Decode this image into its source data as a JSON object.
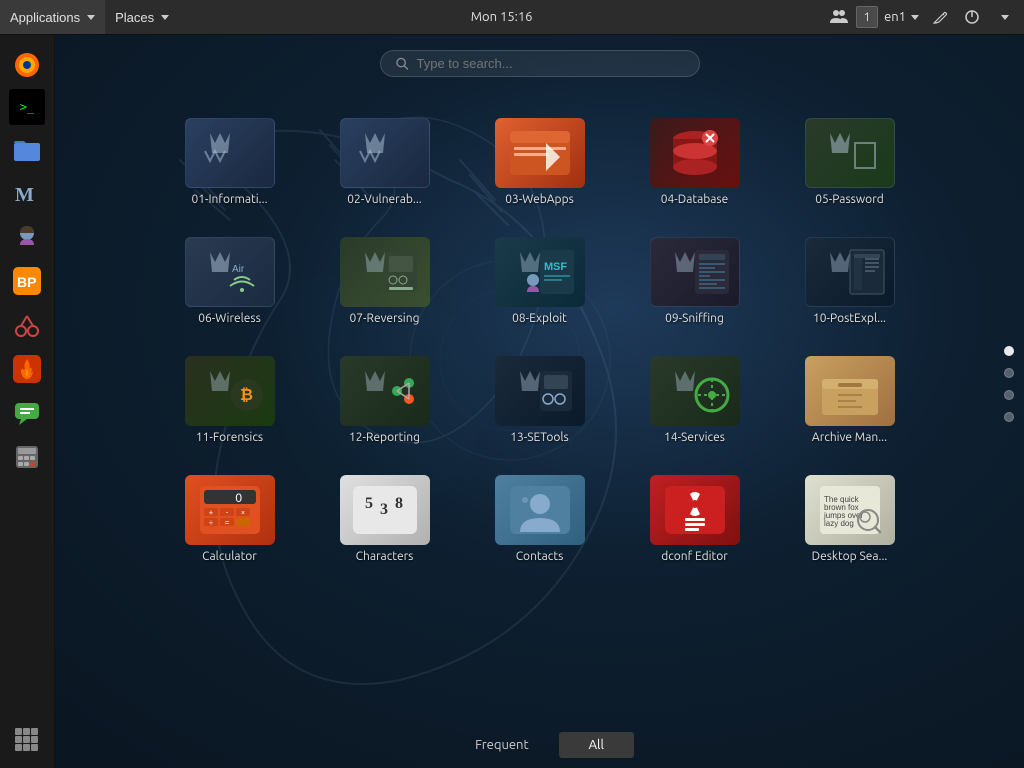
{
  "topbar": {
    "applications_label": "Applications",
    "places_label": "Places",
    "clock": "Mon 15:16",
    "workspace": "1",
    "language": "en↑",
    "lang_text": "en1"
  },
  "search": {
    "placeholder": "Type to search..."
  },
  "apps": [
    {
      "id": "01",
      "label": "01-Informati...",
      "icon_class": "icon-01",
      "glyph": "🔍"
    },
    {
      "id": "02",
      "label": "02-Vulnerab...",
      "icon_class": "icon-02",
      "glyph": "⚡"
    },
    {
      "id": "03",
      "label": "03-WebApps",
      "icon_class": "icon-03",
      "glyph": "🌐"
    },
    {
      "id": "04",
      "label": "04-Database",
      "icon_class": "icon-04",
      "glyph": "🗄"
    },
    {
      "id": "05",
      "label": "05-Password",
      "icon_class": "icon-05",
      "glyph": "🔑"
    },
    {
      "id": "06",
      "label": "06-Wireless",
      "icon_class": "icon-06",
      "glyph": "📡"
    },
    {
      "id": "07",
      "label": "07-Reversing",
      "icon_class": "icon-07",
      "glyph": "🔧"
    },
    {
      "id": "08",
      "label": "08-Exploit",
      "icon_class": "icon-08",
      "glyph": "💥"
    },
    {
      "id": "09",
      "label": "09-Sniffing",
      "icon_class": "icon-09",
      "glyph": "📶"
    },
    {
      "id": "10",
      "label": "10-PostExpl...",
      "icon_class": "icon-10",
      "glyph": "🖥"
    },
    {
      "id": "11",
      "label": "11-Forensics",
      "icon_class": "icon-11",
      "glyph": "🔬"
    },
    {
      "id": "12",
      "label": "12-Reporting",
      "icon_class": "icon-12",
      "glyph": "📊"
    },
    {
      "id": "13",
      "label": "13-SETools",
      "icon_class": "icon-13",
      "glyph": "🛡"
    },
    {
      "id": "14",
      "label": "14-Services",
      "icon_class": "icon-14",
      "glyph": "⚙"
    },
    {
      "id": "archive",
      "label": "Archive Man...",
      "icon_class": "icon-archive",
      "glyph": "📦"
    },
    {
      "id": "calc",
      "label": "Calculator",
      "icon_class": "icon-calc",
      "glyph": "🔢"
    },
    {
      "id": "chars",
      "label": "Characters",
      "icon_class": "icon-chars",
      "glyph": "Ω"
    },
    {
      "id": "contacts",
      "label": "Contacts",
      "icon_class": "icon-contacts",
      "glyph": "👤"
    },
    {
      "id": "dconf",
      "label": "dconf Editor",
      "icon_class": "icon-dconf",
      "glyph": "⚙"
    },
    {
      "id": "desktop-search",
      "label": "Desktop Sea...",
      "icon_class": "icon-desktop-search",
      "glyph": "🔍"
    }
  ],
  "bottom_tabs": [
    {
      "label": "Frequent",
      "active": false
    },
    {
      "label": "All",
      "active": true
    }
  ],
  "sidebar": [
    {
      "name": "firefox",
      "glyph": "🦊",
      "label": "Firefox"
    },
    {
      "name": "terminal",
      "glyph": ">_",
      "label": "Terminal"
    },
    {
      "name": "files",
      "glyph": "📁",
      "label": "Files"
    },
    {
      "name": "kali-logo",
      "glyph": "M",
      "label": "Kali"
    },
    {
      "name": "girl",
      "glyph": "👧",
      "label": "Girl"
    },
    {
      "name": "burpsuite",
      "glyph": "⚡",
      "label": "Burp Suite"
    },
    {
      "name": "cut",
      "glyph": "✂",
      "label": "Cut"
    },
    {
      "name": "flame",
      "glyph": "🔥",
      "label": "Flame"
    },
    {
      "name": "chat",
      "glyph": "💬",
      "label": "Chat"
    },
    {
      "name": "calculator",
      "glyph": "#",
      "label": "Calculator"
    },
    {
      "name": "apps-grid",
      "glyph": "⊞",
      "label": "Apps Grid"
    }
  ],
  "dots": [
    {
      "active": true
    },
    {
      "active": false
    },
    {
      "active": false
    },
    {
      "active": false
    }
  ]
}
